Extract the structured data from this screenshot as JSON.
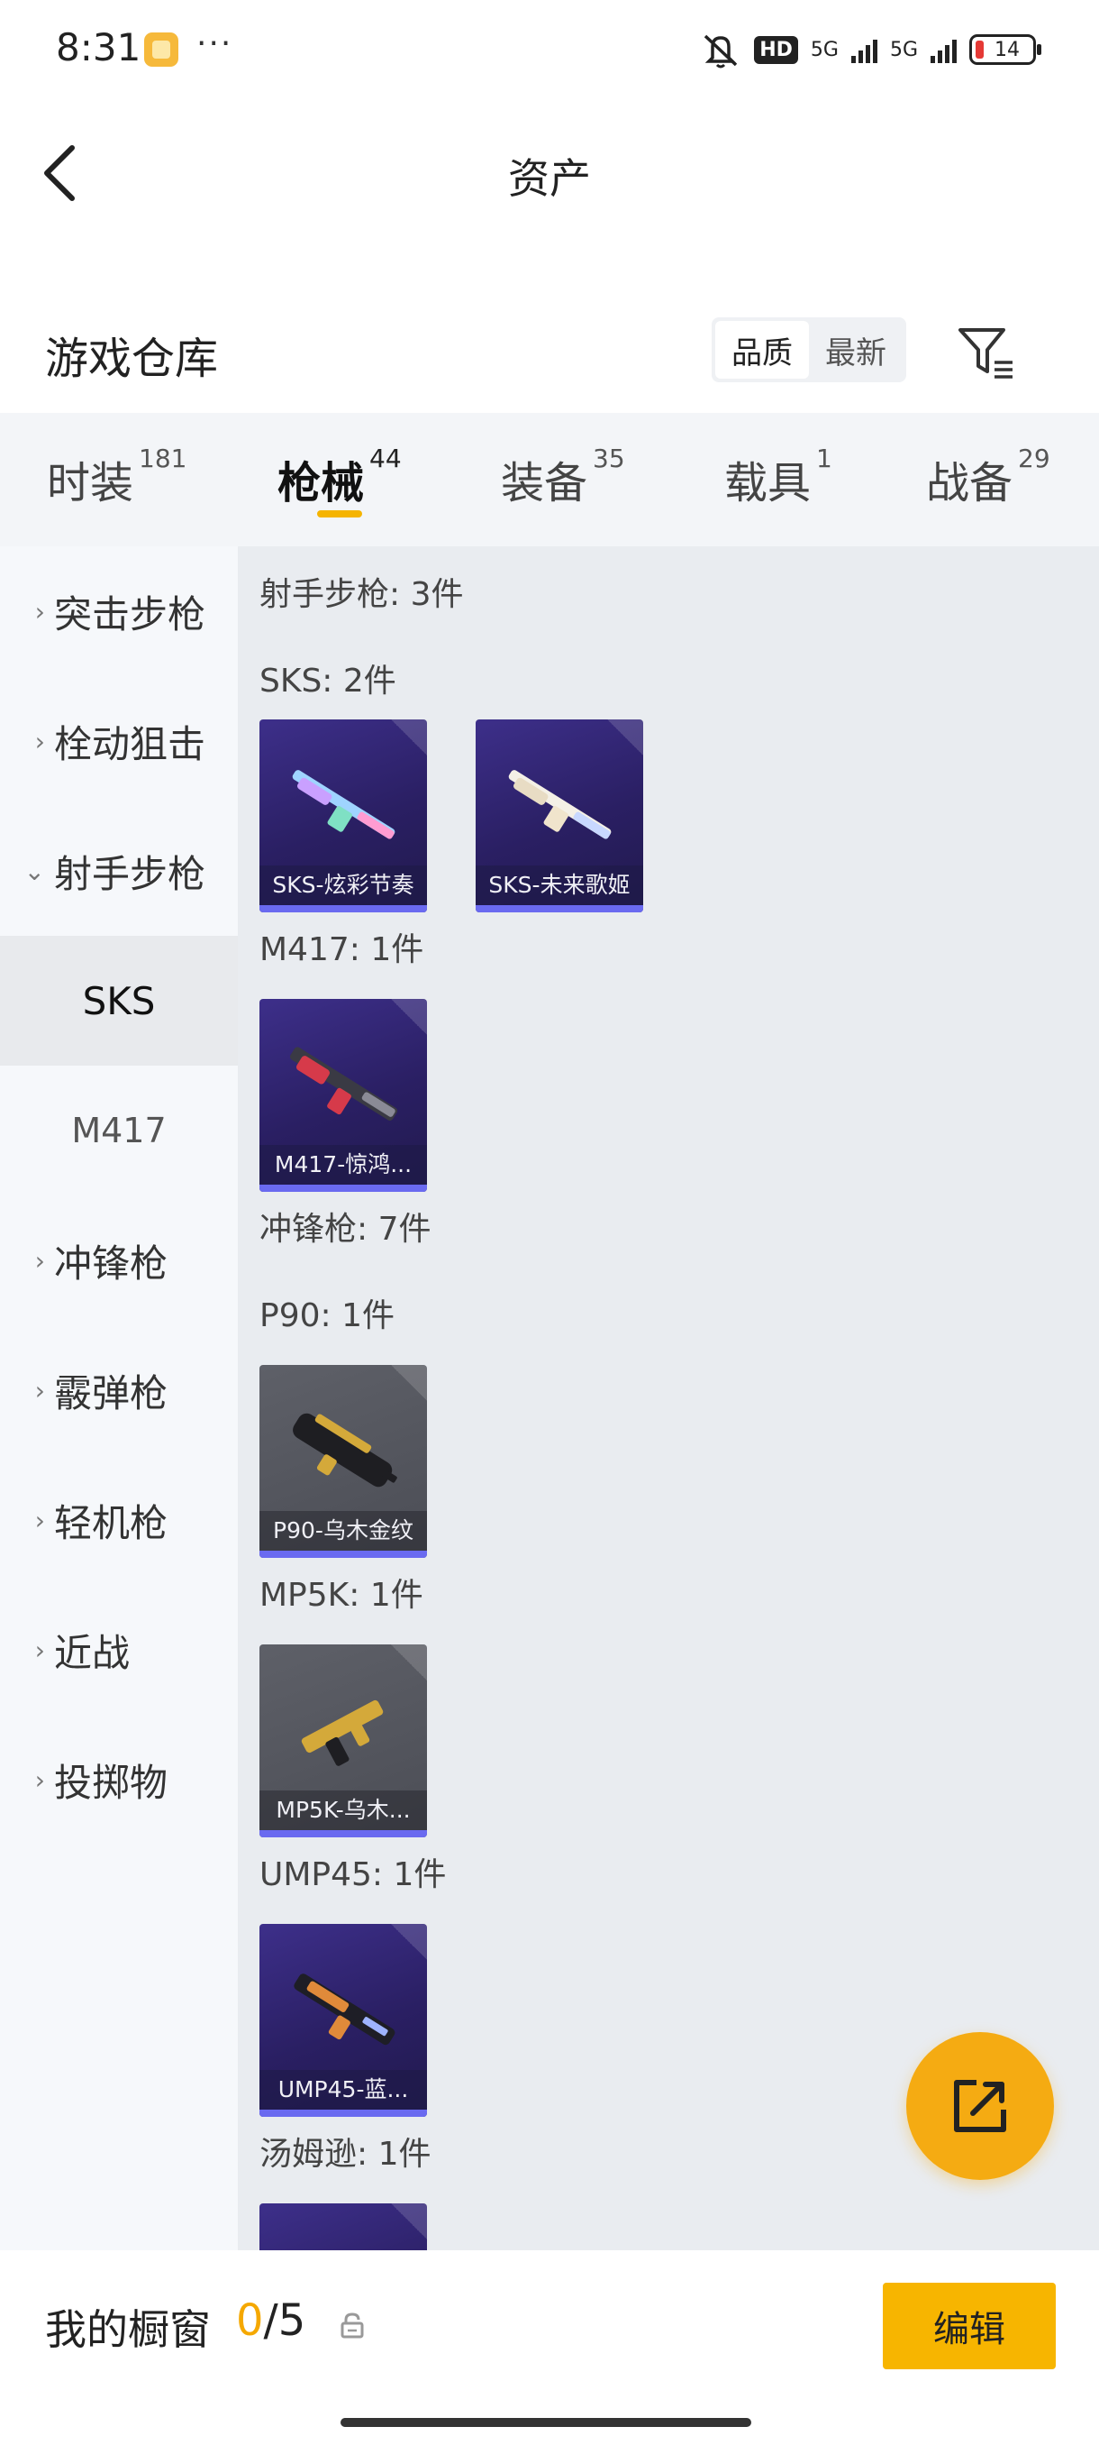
{
  "status_bar": {
    "time": "8:31",
    "more_dots": "···",
    "hd": "HD",
    "net1": "5G",
    "net2": "5G",
    "battery": "14"
  },
  "nav": {
    "title": "资产"
  },
  "warehouse": {
    "title": "游戏仓库",
    "sort_options": [
      "品质",
      "最新"
    ]
  },
  "tabs": [
    {
      "label": "时装",
      "count": "181"
    },
    {
      "label": "枪械",
      "count": "44"
    },
    {
      "label": "装备",
      "count": "35"
    },
    {
      "label": "载具",
      "count": "1"
    },
    {
      "label": "战备",
      "count": "29"
    }
  ],
  "sidebar": {
    "items": [
      {
        "label": "突击步枪",
        "arrow": "›"
      },
      {
        "label": "栓动狙击",
        "arrow": "›"
      },
      {
        "label": "射手步枪",
        "arrow": "⌄"
      },
      {
        "label": "冲锋枪",
        "arrow": "›"
      },
      {
        "label": "霰弹枪",
        "arrow": "›"
      },
      {
        "label": "轻机枪",
        "arrow": "›"
      },
      {
        "label": "近战",
        "arrow": "›"
      },
      {
        "label": "投掷物",
        "arrow": "›"
      }
    ],
    "subitems": [
      "SKS",
      "M417"
    ]
  },
  "content": {
    "labels": [
      "射手步枪: 3件",
      "SKS: 2件",
      "M417: 1件",
      "冲锋枪: 7件",
      "P90: 1件",
      "MP5K: 1件",
      "UMP45: 1件",
      "汤姆逊: 1件"
    ],
    "cards": [
      {
        "name": "SKS-炫彩节奏"
      },
      {
        "name": "SKS-未来歌姬"
      },
      {
        "name": "M417-惊鸿..."
      },
      {
        "name": "P90-乌木金纹"
      },
      {
        "name": "MP5K-乌木..."
      },
      {
        "name": "UMP45-蓝..."
      }
    ]
  },
  "bottom": {
    "showcase_label": "我的橱窗",
    "showcase_current": "0",
    "showcase_max": "/5",
    "edit_label": "编辑"
  },
  "colors": {
    "accent": "#f5b400",
    "card_purple": "#2a1f63",
    "card_grey": "#4b4d55",
    "rarity_bar": "#6a6af0"
  }
}
